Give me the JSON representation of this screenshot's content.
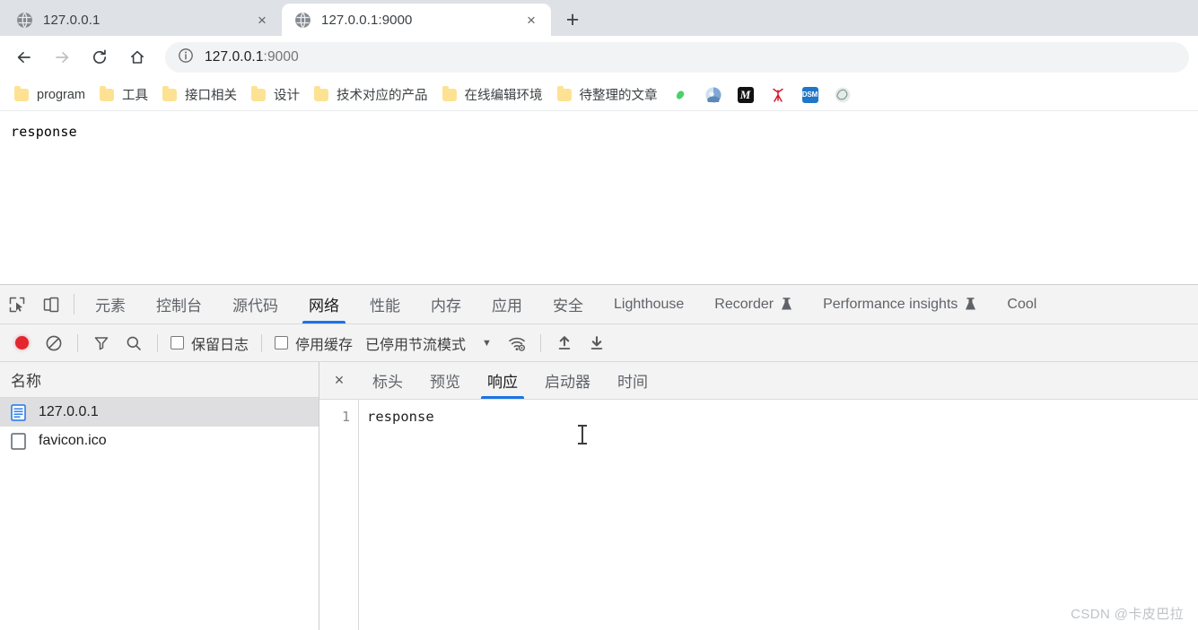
{
  "browser": {
    "tabs": [
      {
        "title": "127.0.0.1",
        "favicon": "globe-icon",
        "active": false
      },
      {
        "title": "127.0.0.1:9000",
        "favicon": "globe-icon",
        "active": true
      }
    ],
    "new_tab_label": "+",
    "tab_close_label": "×",
    "nav": {
      "back": "←",
      "forward": "→",
      "reload": "↻",
      "home": "⌂"
    },
    "omnibox": {
      "url_main": "127.0.0.1",
      "url_port": ":9000",
      "security_icon": "info-circle-icon"
    },
    "bookmarks": [
      {
        "label": "program",
        "type": "folder"
      },
      {
        "label": "工具",
        "type": "folder"
      },
      {
        "label": "接口相关",
        "type": "folder"
      },
      {
        "label": "设计",
        "type": "folder"
      },
      {
        "label": "技术对应的产品",
        "type": "folder"
      },
      {
        "label": "在线编辑环境",
        "type": "folder"
      },
      {
        "label": "待整理的文章",
        "type": "folder"
      }
    ],
    "bookmark_icons": [
      {
        "name": "green-blob-icon",
        "color": "#4ad16b"
      },
      {
        "name": "anime-avatar-icon",
        "color": "#7fa8d6"
      },
      {
        "name": "medium-m-icon",
        "color": "#111111"
      },
      {
        "name": "red-antenna-icon",
        "color": "#d8182a"
      },
      {
        "name": "dsm-icon",
        "color": "#1e77c8"
      },
      {
        "name": "openai-icon",
        "color": "#8fa8a0"
      }
    ]
  },
  "page": {
    "body_text": "response"
  },
  "devtools": {
    "inspect_icon": "inspect-element-icon",
    "device_icon": "device-toolbar-icon",
    "tabs": [
      {
        "label": "元素",
        "selected": false,
        "beaker": false,
        "cn": true
      },
      {
        "label": "控制台",
        "selected": false,
        "beaker": false,
        "cn": true
      },
      {
        "label": "源代码",
        "selected": false,
        "beaker": false,
        "cn": true
      },
      {
        "label": "网络",
        "selected": true,
        "beaker": false,
        "cn": true
      },
      {
        "label": "性能",
        "selected": false,
        "beaker": false,
        "cn": true
      },
      {
        "label": "内存",
        "selected": false,
        "beaker": false,
        "cn": true
      },
      {
        "label": "应用",
        "selected": false,
        "beaker": false,
        "cn": true
      },
      {
        "label": "安全",
        "selected": false,
        "beaker": false,
        "cn": true
      },
      {
        "label": "Lighthouse",
        "selected": false,
        "beaker": false,
        "cn": false
      },
      {
        "label": "Recorder",
        "selected": false,
        "beaker": true,
        "cn": false
      },
      {
        "label": "Performance insights",
        "selected": false,
        "beaker": true,
        "cn": false
      },
      {
        "label": "Cool",
        "selected": false,
        "beaker": false,
        "cn": false
      }
    ],
    "toolbar": {
      "record_icon": "record-stop-icon",
      "clear_icon": "clear-network-icon",
      "filter_icon": "filter-funnel-icon",
      "search_icon": "search-magnifier-icon",
      "preserve_log_label": "保留日志",
      "preserve_log_checked": false,
      "disable_cache_label": "停用缓存",
      "disable_cache_checked": false,
      "throttling_label": "已停用节流模式",
      "throttling_caret": "▼",
      "wifi_icon": "network-conditions-wifi-icon",
      "import_icon": "import-har-up-arrow-icon",
      "export_icon": "export-har-down-arrow-icon"
    },
    "request_list": {
      "header": "名称",
      "rows": [
        {
          "name": "127.0.0.1",
          "icon": "document-icon",
          "selected": true
        },
        {
          "name": "favicon.ico",
          "icon": "generic-file-icon",
          "selected": false
        }
      ]
    },
    "detail": {
      "close_label": "×",
      "tabs": [
        {
          "label": "标头",
          "selected": false
        },
        {
          "label": "预览",
          "selected": false
        },
        {
          "label": "响应",
          "selected": true
        },
        {
          "label": "启动器",
          "selected": false
        },
        {
          "label": "时间",
          "selected": false
        }
      ],
      "code_lines": [
        {
          "number": "1",
          "text": "response"
        }
      ]
    }
  },
  "watermark": "CSDN @卡皮巴拉",
  "colors": {
    "accent": "#1a73e8",
    "record_red": "#e3262f",
    "chrome_tabstrip": "#dee1e6",
    "devtools_bg": "#f3f3f3",
    "selected_row": "#dedee1"
  }
}
